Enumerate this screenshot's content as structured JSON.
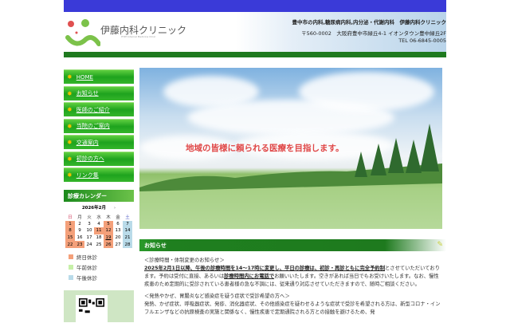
{
  "header": {
    "logo_text": "伊藤内科クリニック",
    "logo_sub": "ITOH Internal Medicine Clinic",
    "tagline": "豊中市の内科,糖尿病内科,内分泌・代謝内科　伊藤内科クリニック",
    "address": "〒560-0002　大阪府豊中市緑丘4-1 イオンタウン豊中緑丘2F",
    "tel": "TEL 06-6845-0005"
  },
  "nav": [
    {
      "label": "HOME"
    },
    {
      "label": "お知らせ"
    },
    {
      "label": "医師のご紹介"
    },
    {
      "label": "当院のご案内"
    },
    {
      "label": "交通案内"
    },
    {
      "label": "初診の方へ"
    },
    {
      "label": "リンク集"
    }
  ],
  "calendar": {
    "heading": "診療カレンダー",
    "month": "2026年2月",
    "next": "›",
    "weekdays": [
      "日",
      "月",
      "火",
      "水",
      "木",
      "金",
      "土"
    ],
    "weeks": [
      [
        1,
        2,
        3,
        4,
        5,
        6,
        7
      ],
      [
        8,
        9,
        10,
        11,
        12,
        13,
        14
      ],
      [
        15,
        16,
        17,
        18,
        19,
        20,
        21
      ],
      [
        22,
        23,
        24,
        25,
        26,
        27,
        28
      ]
    ],
    "closed_all_day": [
      1,
      5,
      8,
      11,
      12,
      15,
      19,
      22,
      23,
      26
    ],
    "closed_afternoon": [
      7,
      14,
      21,
      28
    ],
    "today": 19,
    "legend": [
      {
        "label": "終日休診",
        "color": "#f4a07a"
      },
      {
        "label": "午前休診",
        "color": "#c6f0a8"
      },
      {
        "label": "午後休診",
        "color": "#b9dbe9"
      }
    ]
  },
  "hero": {
    "slogan": "地域の皆様に頼られる医療を目指します。"
  },
  "notice": {
    "title": "お知らせ",
    "h1": "＜診療時間・体制変更のお知らせ＞",
    "p1_bold": "2025年2月1日以降、午後の診療時間を14～17時に変更し、平日の診療は、初診・再診ともに完全予約制",
    "p1_a": "とさせていただいております。予約は受付に直接、あるいは",
    "p1_bold2": "診療時間内にお電話で",
    "p1_b": "お願いいたします。空きがあれば当日でもお受けいたします。なお、慢性疾患のため定期的に受診されている患者様の急な不調には、従来通り対応させていただきますので、随時ご相談ください。",
    "h2": "＜発熱やかぜ、胃腸炎など感染症を疑う症状で受診希望の方へ＞",
    "p2": "発熱、かぜ症状、呼吸器症状、発疹、消化器症状、その他感染症を疑わせるような症状で受診を希望される方は、新型コロナ・インフルエンザなどの抗原検査の実施と関係なく、慢性疾患で定期通院される方との接触を避けるため、発"
  }
}
